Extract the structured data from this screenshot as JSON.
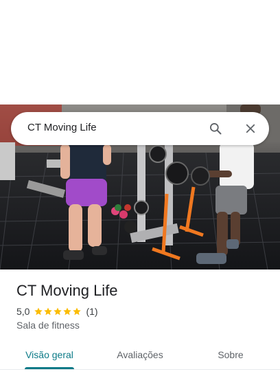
{
  "search": {
    "query": "CT Moving Life",
    "search_icon": "search-icon",
    "close_icon": "close-icon"
  },
  "place": {
    "name": "CT Moving Life",
    "rating": "5,0",
    "rating_fraction": 1.0,
    "review_count": "(1)",
    "category": "Sala de fitness"
  },
  "tabs": [
    {
      "label": "Visão geral",
      "active": true
    },
    {
      "label": "Avaliações",
      "active": false
    },
    {
      "label": "Sobre",
      "active": false
    }
  ],
  "colors": {
    "accent": "#0b7a87",
    "star": "#fbbc04"
  },
  "photo": {
    "subject": "gym-interior-photo"
  }
}
